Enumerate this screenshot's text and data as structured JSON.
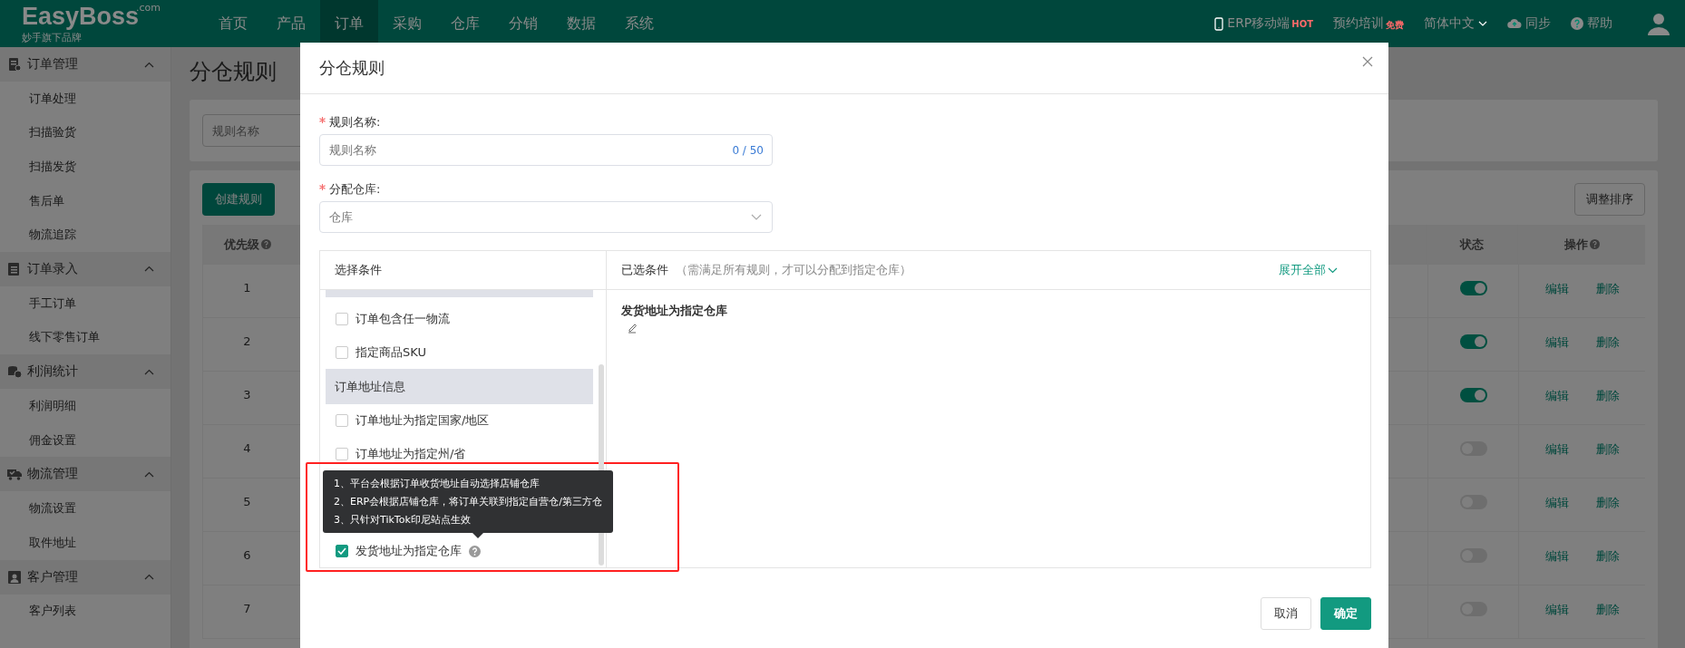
{
  "topbar": {
    "logo": {
      "name": "EasyBoss",
      "suffix": ".com",
      "tagline": "妙手旗下品牌"
    },
    "nav": [
      {
        "label": "首页",
        "selected": false
      },
      {
        "label": "产品",
        "selected": false
      },
      {
        "label": "订单",
        "selected": true
      },
      {
        "label": "采购",
        "selected": false
      },
      {
        "label": "仓库",
        "selected": false
      },
      {
        "label": "分销",
        "selected": false
      },
      {
        "label": "数据",
        "selected": false
      },
      {
        "label": "系统",
        "selected": false
      }
    ],
    "mobile": {
      "label": "ERP移动端",
      "badge": "HOT"
    },
    "training": {
      "label": "预约培训",
      "badge": "免费"
    },
    "language": "简体中文",
    "sync": "同步",
    "help": "帮助"
  },
  "sidebar": {
    "groups": [
      {
        "kind": "order",
        "title": "订单管理",
        "expanded": true,
        "items": [
          "订单处理",
          "扫描验货",
          "扫描发货",
          "售后单",
          "物流追踪"
        ]
      },
      {
        "kind": "entry",
        "title": "订单录入",
        "expanded": true,
        "items": [
          "手工订单",
          "线下零售订单"
        ]
      },
      {
        "kind": "profit",
        "title": "利润统计",
        "expanded": true,
        "items": [
          "利润明细",
          "佣金设置"
        ]
      },
      {
        "kind": "logistics",
        "title": "物流管理",
        "expanded": true,
        "items": [
          "物流设置",
          "取件地址"
        ]
      },
      {
        "kind": "customer",
        "title": "客户管理",
        "expanded": true,
        "items": [
          "客户列表"
        ]
      }
    ]
  },
  "page": {
    "title": "分仓规则",
    "search_placeholder": "规则名称",
    "create_button": "创建规则",
    "sort_button": "调整排序",
    "table": {
      "columns": [
        {
          "label": "优先级",
          "help": true
        },
        {
          "label": "状态",
          "help": false
        },
        {
          "label": "操作",
          "help": true
        }
      ],
      "rows": [
        {
          "priority": "1",
          "enabled": true,
          "actions": [
            "编辑",
            "删除"
          ]
        },
        {
          "priority": "2",
          "enabled": true,
          "actions": [
            "编辑",
            "删除"
          ]
        },
        {
          "priority": "3",
          "enabled": true,
          "actions": [
            "编辑",
            "删除"
          ]
        },
        {
          "priority": "4",
          "enabled": false,
          "actions": [
            "编辑",
            "删除"
          ]
        },
        {
          "priority": "5",
          "enabled": false,
          "actions": [
            "编辑",
            "删除"
          ]
        },
        {
          "priority": "6",
          "enabled": false,
          "actions": [
            "编辑",
            "删除"
          ]
        },
        {
          "priority": "7",
          "enabled": false,
          "actions": [
            "编辑",
            "删除"
          ]
        }
      ]
    }
  },
  "dialog": {
    "title": "分仓规则",
    "fields": [
      {
        "kind": "text",
        "label": "规则名称:",
        "required": true,
        "placeholder": "规则名称",
        "counter": "0 / 50"
      },
      {
        "kind": "select",
        "label": "分配仓库:",
        "required": true,
        "placeholder": "仓库"
      }
    ],
    "conditions": {
      "title": "选择条件",
      "entries": [
        {
          "kind": "option",
          "label": "订单包含任一物流",
          "checked": false
        },
        {
          "kind": "option",
          "label": "指定商品SKU",
          "checked": false
        },
        {
          "kind": "group",
          "label": "订单地址信息"
        },
        {
          "kind": "option",
          "label": "订单地址为指定国家/地区",
          "checked": false
        },
        {
          "kind": "option",
          "label": "订单地址为指定州/省",
          "checked": false
        },
        {
          "kind": "option",
          "label": "发货地址为指定仓库",
          "checked": true,
          "help": true,
          "highlighted": true,
          "tooltip": [
            "1、平台会根据订单收货地址自动选择店铺仓库",
            "2、ERP会根据店铺仓库，将订单关联到指定自营仓/第三方仓",
            "3、只针对TikTok印尼站点生效"
          ]
        }
      ],
      "selected_title": "已选条件",
      "selected_hint": "（需满足所有规则，才可以分配到指定仓库）",
      "expand_link": "展开全部",
      "selected_items": [
        {
          "label": "发货地址为指定仓库"
        }
      ]
    },
    "buttons": [
      {
        "kind": "secondary",
        "label": "取消"
      },
      {
        "kind": "primary",
        "label": "确定"
      }
    ]
  }
}
